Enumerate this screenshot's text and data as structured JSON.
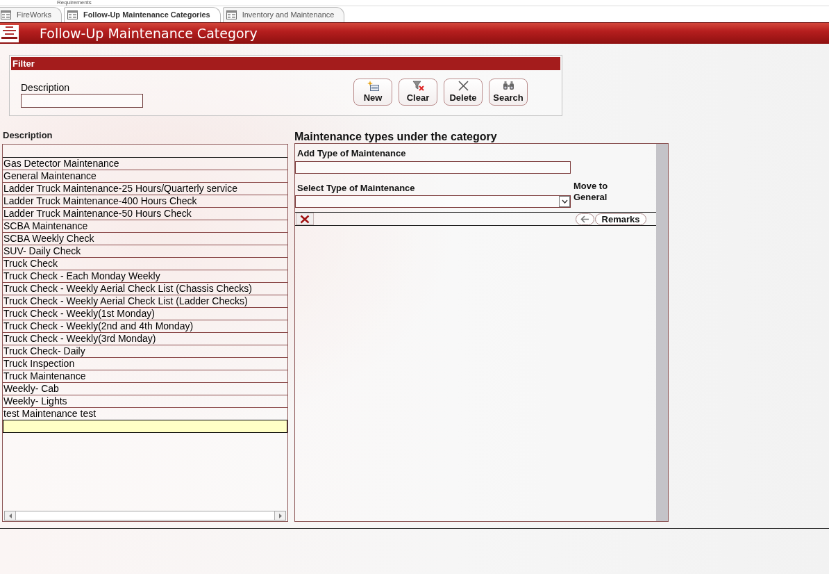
{
  "ribbon": {
    "label": "Requirements"
  },
  "tabs": [
    {
      "label": "FireWorks",
      "selected": false
    },
    {
      "label": "Follow-Up Maintenance Categories",
      "selected": true
    },
    {
      "label": "Inventory and Maintenance",
      "selected": false
    }
  ],
  "header": {
    "title": "Follow-Up Maintenance Category"
  },
  "filter": {
    "title": "Filter",
    "field_label": "Description",
    "buttons": [
      {
        "kind": "new",
        "label": "New"
      },
      {
        "kind": "clear",
        "label": "Clear"
      },
      {
        "kind": "delete",
        "label": "Delete"
      },
      {
        "kind": "search",
        "label": "Search"
      }
    ]
  },
  "list": {
    "column": "Description",
    "rows": [
      {
        "text": "Gas Detector Maintenance",
        "selected": false
      },
      {
        "text": "General Maintenance",
        "selected": false
      },
      {
        "text": "Ladder Truck Maintenance-25 Hours/Quarterly service",
        "selected": false
      },
      {
        "text": "Ladder Truck Maintenance-400 Hours Check",
        "selected": false
      },
      {
        "text": "Ladder Truck Maintenance-50 Hours Check",
        "selected": false
      },
      {
        "text": "SCBA Maintenance",
        "selected": false
      },
      {
        "text": "SCBA Weekly Check",
        "selected": false
      },
      {
        "text": "SUV- Daily Check",
        "selected": false
      },
      {
        "text": "Truck Check",
        "selected": false
      },
      {
        "text": "Truck Check - Each Monday Weekly",
        "selected": false
      },
      {
        "text": "Truck Check - Weekly Aerial Check List (Chassis Checks)",
        "selected": false
      },
      {
        "text": "Truck Check - Weekly Aerial Check List (Ladder Checks)",
        "selected": false
      },
      {
        "text": "Truck Check - Weekly(1st Monday)",
        "selected": false
      },
      {
        "text": "Truck Check - Weekly(2nd and 4th Monday)",
        "selected": false
      },
      {
        "text": "Truck Check - Weekly(3rd Monday)",
        "selected": false
      },
      {
        "text": "Truck Check- Daily",
        "selected": false
      },
      {
        "text": "Truck Inspection",
        "selected": false
      },
      {
        "text": "Truck Maintenance",
        "selected": false
      },
      {
        "text": "Weekly- Cab",
        "selected": false
      },
      {
        "text": "Weekly- Lights",
        "selected": false
      },
      {
        "text": "test Maintenance test",
        "selected": false
      }
    ],
    "new_row": {
      "selected": true
    }
  },
  "detail": {
    "title": "Maintenance types under the category",
    "add_label": "Add Type of Maintenance",
    "select_label": "Select Type of Maintenance",
    "move_label": "Move to General",
    "remarks_button": "Remarks"
  }
}
